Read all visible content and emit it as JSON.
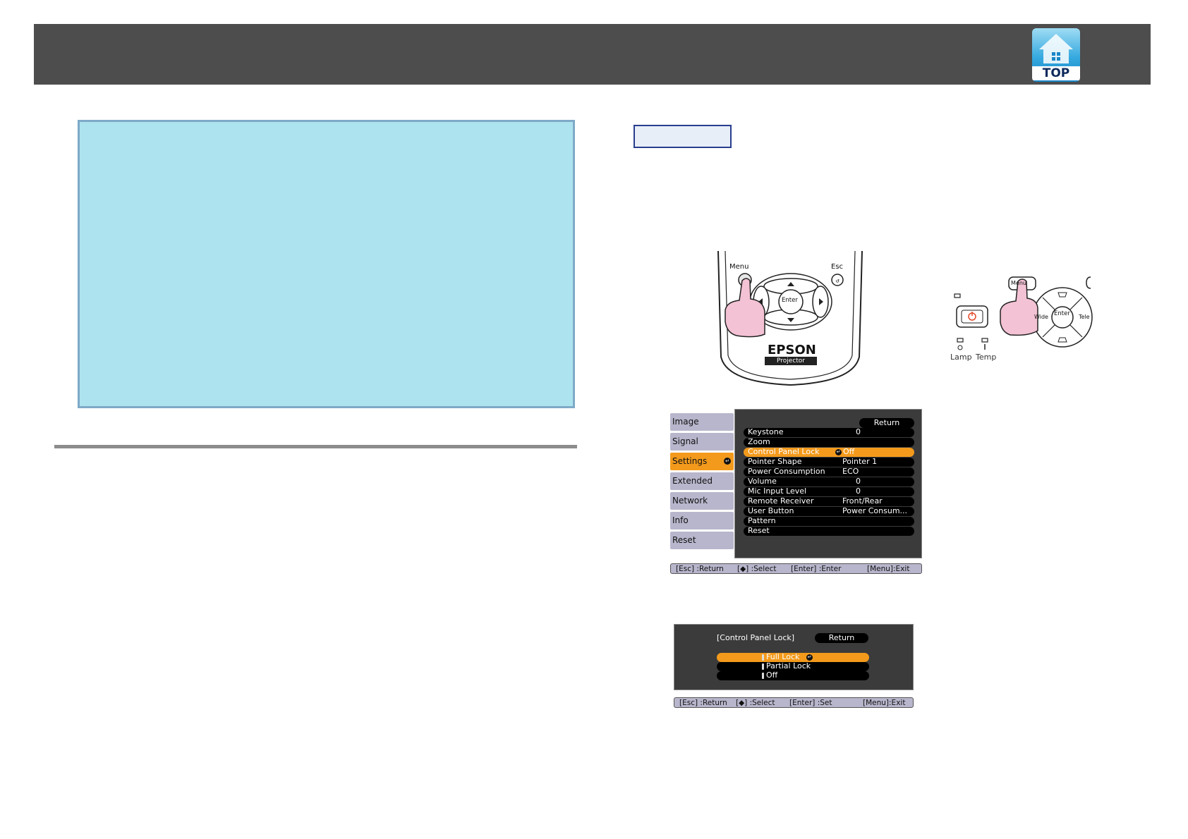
{
  "header": {
    "top_icon": {
      "label": "TOP",
      "icon": "top-home-icon"
    }
  },
  "remote": {
    "menu_label": "Menu",
    "esc_label": "Esc",
    "enter_label": "Enter",
    "brand": "EPSON",
    "projector_label": "Projector"
  },
  "control_panel": {
    "menu_label": "Menu",
    "enter_label": "Enter",
    "wide_label": "Wide",
    "tele_label": "Tele",
    "lamp_label": "Lamp",
    "temp_label": "Temp"
  },
  "settings_menu": {
    "tabs": [
      {
        "label": "Image"
      },
      {
        "label": "Signal"
      },
      {
        "label": "Settings"
      },
      {
        "label": "Extended"
      },
      {
        "label": "Network"
      },
      {
        "label": "Info"
      },
      {
        "label": "Reset"
      }
    ],
    "return_label": "Return",
    "rows": [
      {
        "label": "Keystone",
        "value": "0"
      },
      {
        "label": "Zoom",
        "value": ""
      },
      {
        "label": "Control Panel Lock",
        "value": "Off"
      },
      {
        "label": "Pointer Shape",
        "value": "Pointer 1"
      },
      {
        "label": "Power Consumption",
        "value": "ECO"
      },
      {
        "label": "Volume",
        "value": "0"
      },
      {
        "label": "Mic Input Level",
        "value": "0"
      },
      {
        "label": "Remote Receiver",
        "value": "Front/Rear"
      },
      {
        "label": "User Button",
        "value": "Power Consum..."
      },
      {
        "label": "Pattern",
        "value": ""
      },
      {
        "label": "Reset",
        "value": ""
      }
    ],
    "help": {
      "esc": "[Esc] :Return",
      "select": "[◆] :Select",
      "enter": "[Enter] :Enter",
      "menu": "[Menu]:Exit"
    }
  },
  "lock_dialog": {
    "title": "[Control Panel Lock]",
    "return_label": "Return",
    "options": [
      {
        "label": "Full Lock"
      },
      {
        "label": "Partial Lock"
      },
      {
        "label": "Off"
      }
    ],
    "help": {
      "esc": "[Esc] :Return",
      "select": "[◆] :Select",
      "enter": "[Enter] :Set",
      "menu": "[Menu]:Exit"
    }
  },
  "colors": {
    "header": "#4d4d4d",
    "note_background": "#ade3ee",
    "menu_highlight": "#f39a1c",
    "tab_inactive": "#b8b6cc"
  }
}
